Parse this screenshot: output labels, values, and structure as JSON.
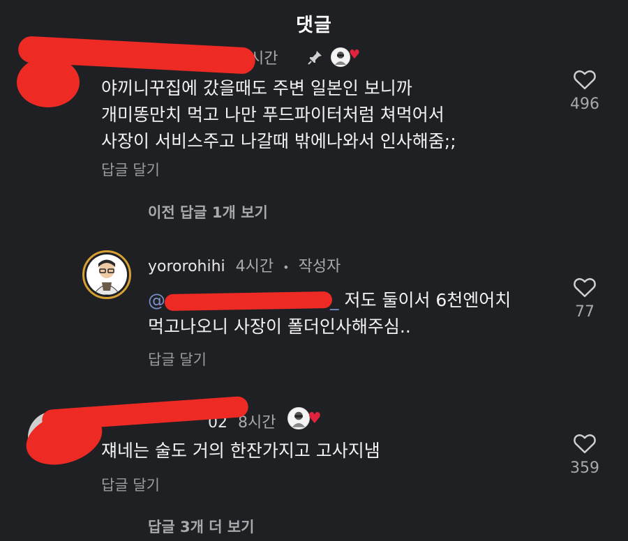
{
  "header": {
    "title": "댓글"
  },
  "comments": [
    {
      "time": "11시간",
      "lines": [
        "야끼니꾸집에 갔을때도 주변 일본인 보니까",
        "개미똥만치 먹고 나만 푸드파이터처럼 쳐먹어서",
        "사장이 서비스주고 나갈때 밖에나와서 인사해줌;;"
      ],
      "reply_label": "답글 달기",
      "likes": "496"
    },
    {
      "view_more": "이전 답글 1개 보기"
    },
    {
      "username": "yororohihi",
      "time": "4시간",
      "dot": "•",
      "role": "작성자",
      "mention_prefix": "@",
      "mention_tail": "_",
      "line1_rest": "저도 둘이서 6천엔어치",
      "line2": "먹고나오니 사장이 폴더인사해주심..",
      "reply_label": "답글 달기",
      "likes": "77"
    },
    {
      "username_tail": "02",
      "time": "8시간",
      "lines": [
        "쟤네는 술도 거의 한잔가지고 고사지냄"
      ],
      "reply_label": "답글 달기",
      "likes": "359",
      "view_more": "답글 3개 더 보기"
    }
  ],
  "icons": {
    "heart": "heart-outline-icon",
    "liked_badge": "heart-filled-icon",
    "pin": "pin-icon"
  },
  "colors": {
    "background": "#1f2024",
    "redaction": "#ee2a24",
    "creator_ring": "#d6a032",
    "mention": "#7a8fc9"
  }
}
